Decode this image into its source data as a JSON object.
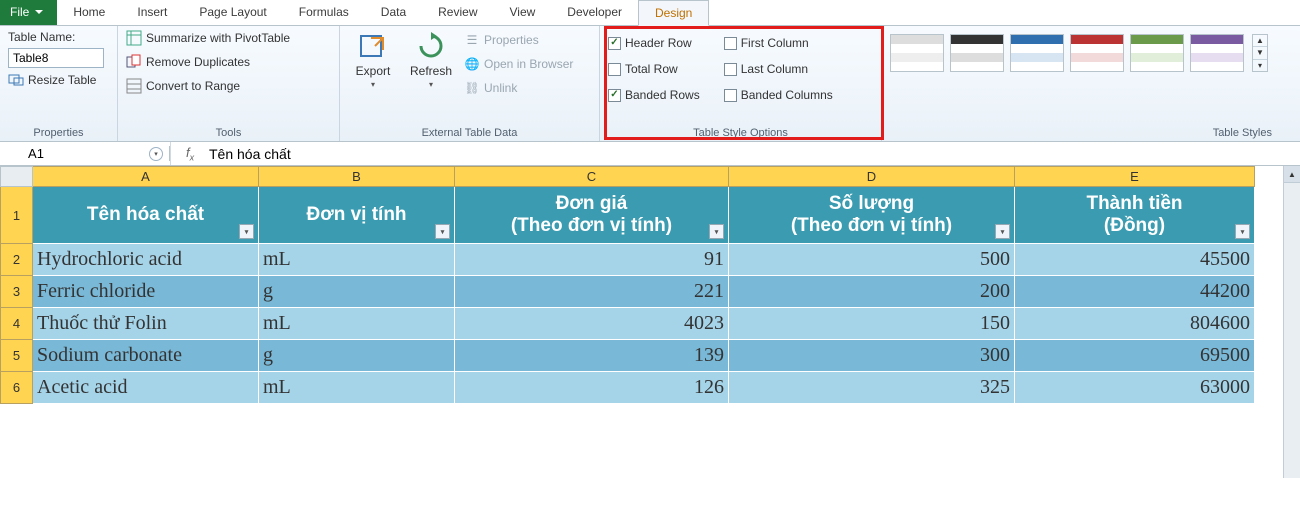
{
  "tabs": {
    "file": "File",
    "items": [
      "Home",
      "Insert",
      "Page Layout",
      "Formulas",
      "Data",
      "Review",
      "View",
      "Developer",
      "Design"
    ],
    "active": "Design"
  },
  "ribbon": {
    "properties": {
      "title": "Properties",
      "label_table_name": "Table Name:",
      "table_name_value": "Table8",
      "resize": "Resize Table"
    },
    "tools": {
      "title": "Tools",
      "pivot": "Summarize with PivotTable",
      "remove_dupes": "Remove Duplicates",
      "convert": "Convert to Range"
    },
    "external": {
      "title": "External Table Data",
      "export": "Export",
      "refresh": "Refresh",
      "properties": "Properties",
      "browser": "Open in Browser",
      "unlink": "Unlink"
    },
    "style_options": {
      "title": "Table Style Options",
      "header_row": "Header Row",
      "total_row": "Total Row",
      "banded_rows": "Banded Rows",
      "first_col": "First Column",
      "last_col": "Last Column",
      "banded_cols": "Banded Columns",
      "checked": {
        "header_row": true,
        "total_row": false,
        "banded_rows": true,
        "first_col": false,
        "last_col": false,
        "banded_cols": false
      }
    },
    "styles": {
      "title": "Table Styles"
    }
  },
  "namebox": {
    "cell": "A1"
  },
  "formula": {
    "value": "Tên hóa chất"
  },
  "columns": [
    "A",
    "B",
    "C",
    "D",
    "E"
  ],
  "headers": {
    "A": "Tên hóa chất",
    "B": "Đơn vị tính",
    "C": "Đơn giá\n(Theo đơn vị tính)",
    "D": "Số lượng\n(Theo đơn vị tính)",
    "E": "Thành tiền\n(Đồng)"
  },
  "rows": [
    {
      "n": "2",
      "A": "Hydrochloric acid",
      "B": "mL",
      "C": "91",
      "D": "500",
      "E": "45500"
    },
    {
      "n": "3",
      "A": "Ferric chloride",
      "B": "g",
      "C": "221",
      "D": "200",
      "E": "44200"
    },
    {
      "n": "4",
      "A": "Thuốc thử Folin",
      "B": "mL",
      "C": "4023",
      "D": "150",
      "E": "804600"
    },
    {
      "n": "5",
      "A": "Sodium carbonate",
      "B": "g",
      "C": "139",
      "D": "300",
      "E": "69500"
    },
    {
      "n": "6",
      "A": "Acetic acid",
      "B": "mL",
      "C": "126",
      "D": "325",
      "E": "63000"
    }
  ],
  "chart_data": {
    "type": "table",
    "columns": [
      "Tên hóa chất",
      "Đơn vị tính",
      "Đơn giá (Theo đơn vị tính)",
      "Số lượng (Theo đơn vị tính)",
      "Thành tiền (Đồng)"
    ],
    "rows": [
      [
        "Hydrochloric acid",
        "mL",
        91,
        500,
        45500
      ],
      [
        "Ferric chloride",
        "g",
        221,
        200,
        44200
      ],
      [
        "Thuốc thử Folin",
        "mL",
        4023,
        150,
        804600
      ],
      [
        "Sodium carbonate",
        "g",
        139,
        300,
        69500
      ],
      [
        "Acetic acid",
        "mL",
        126,
        325,
        63000
      ]
    ]
  }
}
